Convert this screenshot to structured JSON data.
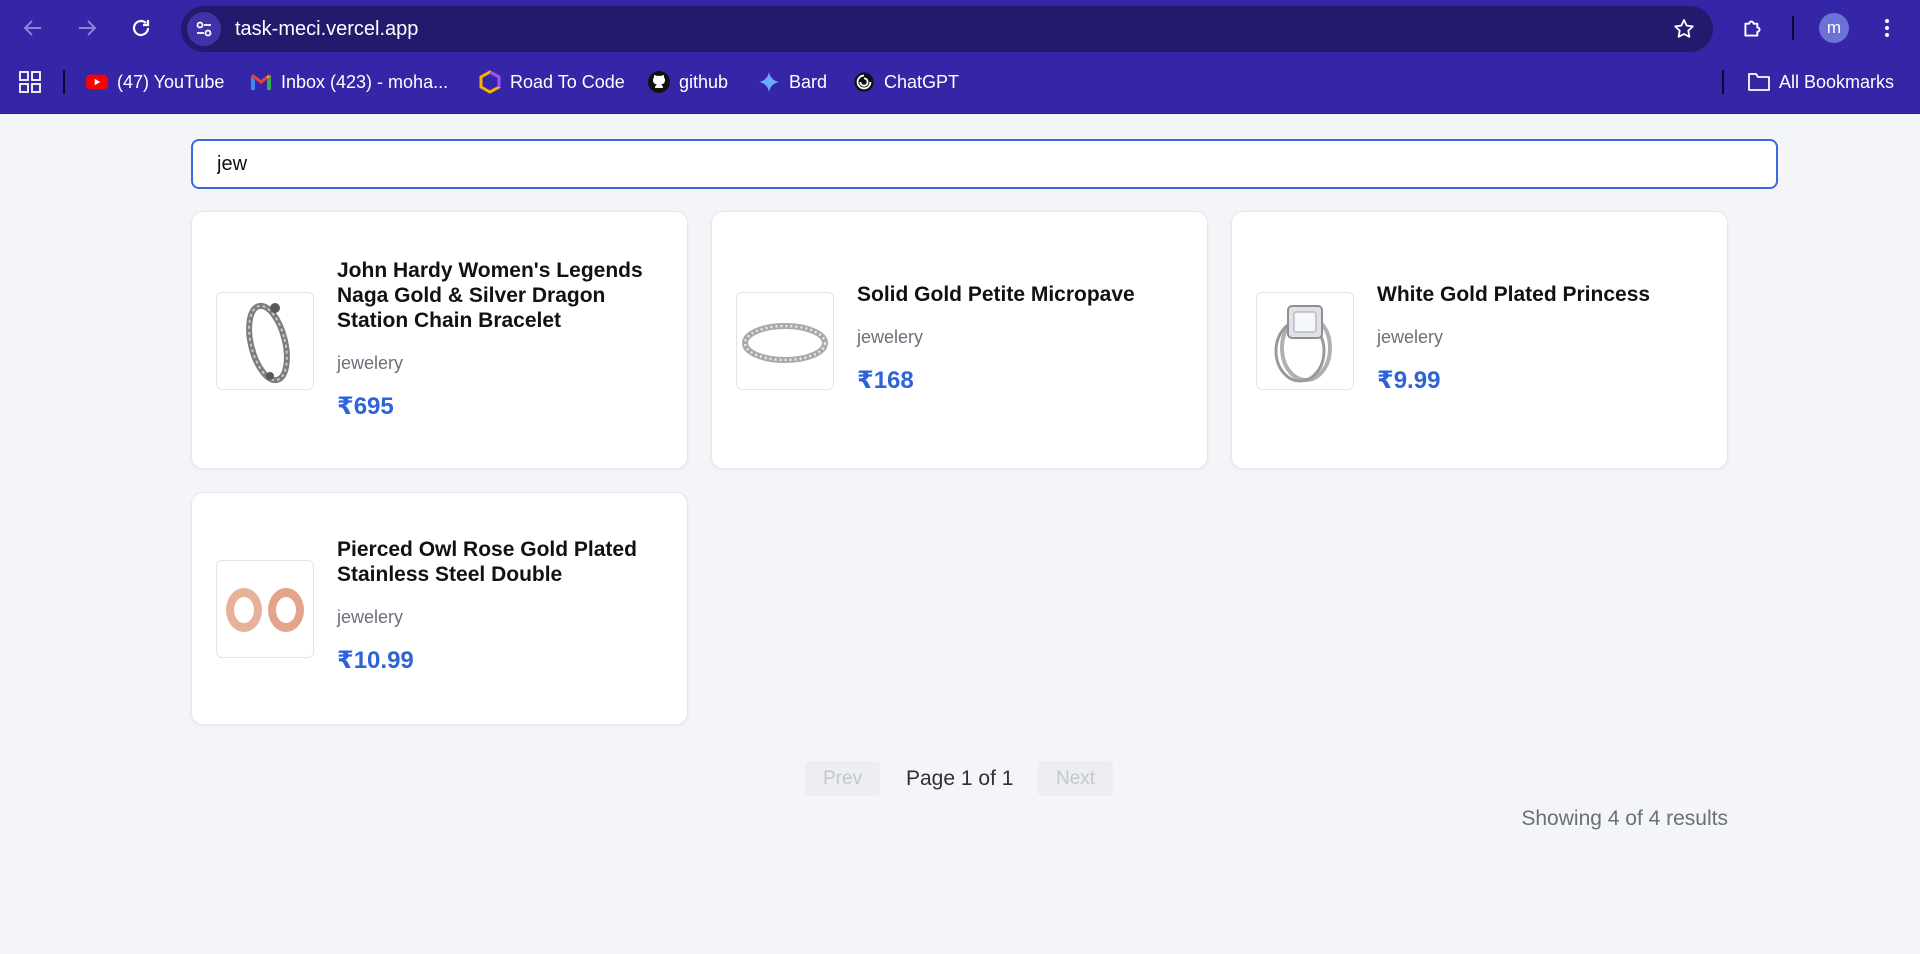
{
  "browser": {
    "url": "task-meci.vercel.app",
    "profile_initial": "m",
    "bookmarks": [
      {
        "label": "(47) YouTube",
        "icon": "youtube-icon"
      },
      {
        "label": "Inbox (423) - moha...",
        "icon": "gmail-icon"
      },
      {
        "label": "Road To Code",
        "icon": "road-to-code-icon"
      },
      {
        "label": "github",
        "icon": "github-icon"
      },
      {
        "label": "Bard",
        "icon": "bard-icon"
      },
      {
        "label": "ChatGPT",
        "icon": "chatgpt-icon"
      }
    ],
    "all_bookmarks": "All Bookmarks"
  },
  "search": {
    "value": "jew"
  },
  "products": [
    {
      "title": "John Hardy Women's Legends Naga Gold & Silver Dragon Station Chain Bracelet",
      "category": "jewelery",
      "price": "₹695"
    },
    {
      "title": "Solid Gold Petite Micropave",
      "category": "jewelery",
      "price": "₹168"
    },
    {
      "title": "White Gold Plated Princess",
      "category": "jewelery",
      "price": "₹9.99"
    },
    {
      "title": "Pierced Owl Rose Gold Plated Stainless Steel Double",
      "category": "jewelery",
      "price": "₹10.99"
    }
  ],
  "pagination": {
    "prev": "Prev",
    "page_text": "Page 1 of 1",
    "next": "Next"
  },
  "results_text": "Showing 4 of 4 results",
  "colors": {
    "accent": "#2f63d8",
    "chrome": "#3525a7",
    "background": "#f4f5f8"
  }
}
